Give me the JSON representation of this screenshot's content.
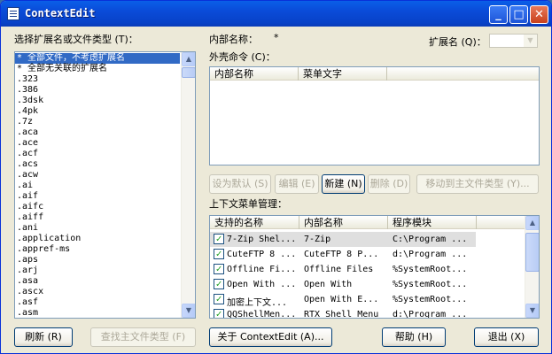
{
  "window": {
    "title": "ContextEdit",
    "minimize": "_",
    "maximize": "□",
    "close": "✕"
  },
  "left": {
    "label": "选择扩展名或文件类型 (T)：",
    "items": [
      "* 全部文件，不考虑扩展名",
      "* 全部无关联的扩展名",
      ".323",
      ".386",
      ".3dsk",
      ".4pk",
      ".7z",
      ".aca",
      ".ace",
      ".acf",
      ".acs",
      ".acw",
      ".ai",
      ".aif",
      ".aifc",
      ".aiff",
      ".ani",
      ".application",
      ".appref-ms",
      ".aps",
      ".arj",
      ".asa",
      ".ascx",
      ".asf",
      ".asm"
    ],
    "selected_index": 0
  },
  "internal_name": {
    "label": "内部名称：",
    "value": "*"
  },
  "extension": {
    "label": "扩展名 (Q)：",
    "value": ""
  },
  "shell": {
    "label": "外壳命令 (C)：",
    "columns": [
      "内部名称",
      "菜单文字"
    ]
  },
  "shell_buttons": {
    "set_default": "设为默认 (S)",
    "edit": "编辑 (E)",
    "new": "新建 (N)",
    "delete": "删除 (D)",
    "move": "移动到主文件类型 (Y)..."
  },
  "context": {
    "label": "上下文菜单管理：",
    "columns": [
      "支持的名称",
      "内部名称",
      "程序模块"
    ],
    "rows": [
      {
        "name": "7-Zip Shel...",
        "internal": "7-Zip",
        "module": "C:\\Program ..."
      },
      {
        "name": "CuteFTP 8 ...",
        "internal": "CuteFTP 8 P...",
        "module": "d:\\Program ..."
      },
      {
        "name": "Offline Fi...",
        "internal": "Offline Files",
        "module": "%SystemRoot..."
      },
      {
        "name": "Open With ...",
        "internal": "Open With",
        "module": "%SystemRoot..."
      },
      {
        "name": "加密上下文...",
        "internal": "Open With E...",
        "module": "%SystemRoot..."
      },
      {
        "name": "QQShellMen...",
        "internal": "RTX Shell Menu",
        "module": "d:\\Program ..."
      }
    ],
    "check_mark": "✓"
  },
  "bottom_buttons": {
    "refresh": "刷新 (R)",
    "find_main": "查找主文件类型 (F)",
    "about": "关于 ContextEdit (A)...",
    "help": "帮助 (H)",
    "exit": "退出 (X)"
  },
  "icons": {
    "scroll_up": "▲",
    "scroll_down": "▼",
    "combo_arrow": "▼"
  }
}
